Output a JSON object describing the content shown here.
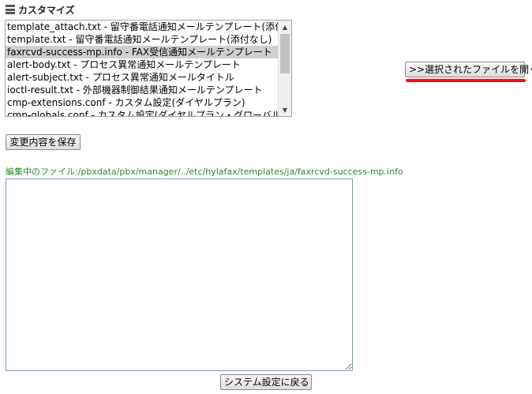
{
  "section": {
    "title": "カスタマイズ"
  },
  "file_list": {
    "items": [
      "template_attach.txt - 留守番電話通知メールテンプレート(添付有り)",
      "template.txt - 留守番電話通知メールテンプレート(添付なし)",
      "faxrcvd-success-mp.info - FAX受信通知メールテンプレート",
      "alert-body.txt - プロセス異常通知メールテンプレート",
      "alert-subject.txt - プロセス異常通知メールタイトル",
      "ioctl-result.txt - 外部機器制御結果通知メールテンプレート",
      "cmp-extensions.conf - カスタム設定(ダイヤルプラン)",
      "cmp-globals.conf - カスタム設定(ダイヤルプラン・グローバル変数)"
    ],
    "selected_index": 2
  },
  "buttons": {
    "open_file": ">>選択されたファイルを開く",
    "save": "変更内容を保存",
    "back": "システム設定に戻る"
  },
  "editing": {
    "path_text": "編集中のファイル:/pbxdata/pbx/manager/../etc/hylafax/templates/ja/faxrcvd-success-mp.info",
    "content": ""
  },
  "colors": {
    "highlight_underline": "#e8141c",
    "path_text": "#2a8a2a",
    "selected_row": "#cfcfcf"
  }
}
